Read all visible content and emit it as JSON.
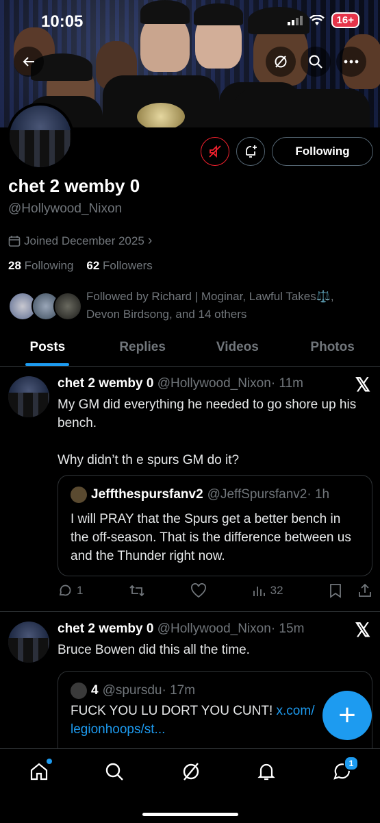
{
  "status_bar": {
    "time": "10:05",
    "battery": "16+"
  },
  "profile": {
    "display_name": "chet 2 wemby 0",
    "handle": "@Hollywood_Nixon",
    "joined": "Joined December 2025",
    "following_count": "28",
    "following_label": "Following",
    "followers_count": "62",
    "followers_label": "Followers",
    "followed_by": "Followed by Richard | Moginar, Lawful Takes⚖️, Devon Birdsong, and 14 others",
    "follow_button": "Following"
  },
  "tabs": [
    "Posts",
    "Replies",
    "Videos",
    "Photos"
  ],
  "posts": [
    {
      "name": "chet 2 wemby 0",
      "handle": "@Hollywood_Nixon",
      "time": "· 11m",
      "text": "My GM did everything he needed to go shore up his bench.\n\nWhy didn’t th e spurs GM do it?",
      "quote": {
        "name": "Jeffthespursfanv2",
        "handle": "@JeffSpursfanv2",
        "time": "· 1h",
        "text": "I will PRAY that the Spurs get a better bench in the off-season. That is the difference between us and the Thunder right now."
      },
      "replies": "1",
      "views": "32"
    },
    {
      "name": "chet 2 wemby 0",
      "handle": "@Hollywood_Nixon",
      "time": "· 15m",
      "text": "Bruce Bowen did this all the time.",
      "quote": {
        "name": "4",
        "handle": "@spursdu",
        "time": "· 17m",
        "text": "FUCK YOU LU DORT YOU CUNT! ",
        "link1": "x.com/",
        "link2": "legionhoops/st..."
      }
    }
  ],
  "fab_label": "+",
  "nav_badge": "1",
  "colors": {
    "accent": "#1d9bf0",
    "muted": "#71767b",
    "danger": "#f4212e"
  }
}
